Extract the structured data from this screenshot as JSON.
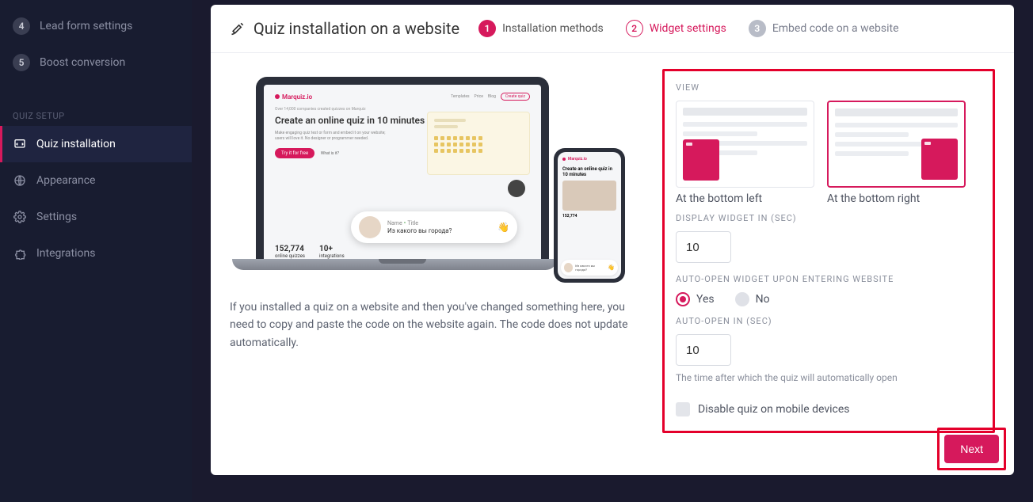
{
  "sidebar": {
    "steps": [
      {
        "num": "4",
        "label": "Lead form settings"
      },
      {
        "num": "5",
        "label": "Boost conversion"
      }
    ],
    "section_label": "QUIZ SETUP",
    "items": [
      {
        "label": "Quiz installation"
      },
      {
        "label": "Appearance"
      },
      {
        "label": "Settings"
      },
      {
        "label": "Integrations"
      }
    ]
  },
  "header": {
    "title": "Quiz installation on a website",
    "steps": [
      {
        "num": "1",
        "label": "Installation methods"
      },
      {
        "num": "2",
        "label": "Widget settings"
      },
      {
        "num": "3",
        "label": "Embed code on a website"
      }
    ]
  },
  "preview": {
    "brand": "Marquiz.io",
    "tagline": "Over 14,000 companies created quizzes on Marquiz",
    "hero": "Create an online quiz in 10 minutes",
    "sub": "Make engaging quiz test or form and embed it on your website; users will love it. No designer or programmer needed.",
    "cta": "Try it for free",
    "cta2": "What is it?",
    "stat1_num": "152,774",
    "stat1_lab": "online quizzes",
    "stat2_num": "10+",
    "stat2_lab": "integrations",
    "chat_name": "Name",
    "chat_title": "Title",
    "chat_q": "Из какого вы города?",
    "phone_title": "Create an online quiz in 10 minutes",
    "phone_stat": "152,774"
  },
  "note": "If you installed a quiz on a website and then you've changed something here, you need to copy and paste the code on the website again. The code does not update automatically.",
  "panel": {
    "view_label": "VIEW",
    "opt_left": "At the bottom left",
    "opt_right": "At the bottom right",
    "display_label": "DISPLAY WIDGET IN (SEC)",
    "display_value": "10",
    "autoopen_label": "AUTO-OPEN WIDGET UPON ENTERING WEBSITE",
    "yes": "Yes",
    "no": "No",
    "autoopen_sec_label": "AUTO-OPEN IN (SEC)",
    "autoopen_sec_value": "10",
    "help": "The time after which the quiz will automatically open",
    "disable_mobile": "Disable quiz on mobile devices"
  },
  "next": "Next"
}
